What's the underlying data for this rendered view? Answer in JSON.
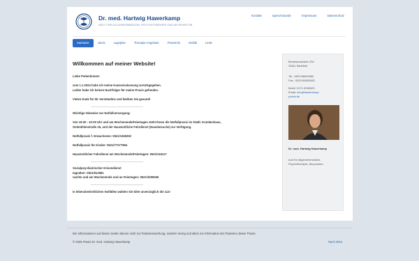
{
  "header": {
    "title": "Dr. med. Hartwig Hawerkamp",
    "subtitle": "ARZT FÜR ALLGEMEINMEDIZIN, PSYCHOTHERAPIE UND AKUPUNKTUR",
    "top_links": [
      "Kontakt",
      "Sprechstunde",
      "Impressum",
      "Datenschutz"
    ]
  },
  "nav": {
    "items": [
      "Startseite",
      "Jarvis",
      "Lageplan",
      "Therapie-Angebote",
      "Praxisinfo",
      "Notfall",
      "Links"
    ],
    "active": "Startseite"
  },
  "main": {
    "title": "Willkommen auf meiner Website!",
    "greeting": "Liebe Patientinnen!",
    "notice_1": "zum 1.1.2024 habe ich meine Kassenzulassung zurückgegeben.",
    "notice_2": "Leider habe ich keinen Nachfolger für meine Praxis gefunden.",
    "thanks": "Vielen Dank für Ihr Verständnis und bleiben Sie gesund!",
    "hint_heading": "Wichtige Hinweise zur Notfallversorgung:",
    "emergency_1": "Von 19:00 - 22:00 Uhr und am Wochenende/Feiertagen steht Ihnen die Notfallpraxis im Städt. Krankenhaus,",
    "emergency_2": "Oelmühlenstraße 26, und der Hausärztliche Fahrdienst (Hausbesuche) zur Verfügung.",
    "practice_adults": "Notfallpraxis f. Erwachsene: 0521/1369292",
    "practice_children": "Notfallpraxis für Kinder: 0521/77277994",
    "driving_service": "Hausärztlicher Fahrdienst am Wochenende/Feiertagen: 0521/116117",
    "crisis_1": "Sozialpsychiatrischer Krisendienst",
    "crisis_2": "tagsüber: 0521/512581",
    "crisis_3": "nachts und am Wochenende und an Feiertagen: 0521/3299265",
    "final": "In lebensbedrohlichen Notfällen wählen Sie bitte unverzüglich die 112!"
  },
  "sidebar": {
    "street": "Beckhausstraße 234",
    "city": "33611 Bielefeld",
    "phone": "Tel.: 0521/98900580",
    "fax": "Fax.: 0521/98900582",
    "mobile": "Mobil: 0171-9938323",
    "email_label": "Email:",
    "email_1": "info@hawerkamp-",
    "email_2": "praxis.de",
    "name": "Dr. med. Hartwig Hawerkamp",
    "desc_1": "Arzt für Allgemeinmedizin,",
    "desc_2": "Psychotherapie, Akupunktur"
  },
  "footer": {
    "text": "Die Informationen auf diesen Seiten dienen nicht zur Patientenwerbung, sondern einzig und allein zur Information der Patienten dieser Praxis.",
    "copyright": "© 2025 Praxis Dr. med. Hartwig Hawerkamp",
    "back_to_top": "Nach oben"
  },
  "colors": {
    "accent": "#2a6bc4",
    "background": "#dde3ea"
  }
}
